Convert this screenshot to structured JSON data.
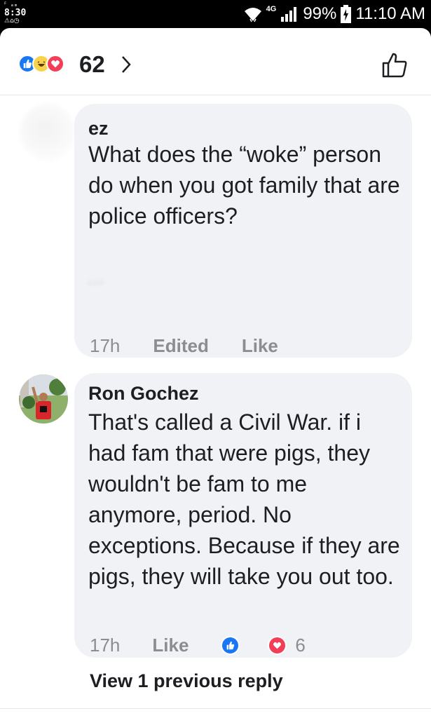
{
  "status_bar": {
    "left_mini": "ꟳ ₐₘ",
    "left_clock": "8:30",
    "left_icons": "⚠⌂◷",
    "network": "4G",
    "battery": "99%",
    "time": "11:10 AM",
    "icons": [
      "wifi-icon",
      "signal-icon",
      "battery-icon"
    ]
  },
  "reactions": {
    "icons": [
      "like-reaction-icon",
      "haha-reaction-icon",
      "love-reaction-icon"
    ],
    "count": "62"
  },
  "comments": [
    {
      "author": "ez",
      "text": "What does the “woke” person do when you got family that are police officers?",
      "blurred_tail": "...",
      "time": "17h",
      "edited": "Edited",
      "like_label": "Like"
    },
    {
      "author": "Ron Gochez",
      "text": "That's called a Civil War. if i had fam that were pigs, they wouldn't be fam to me anymore, period. No exceptions. Because if they are pigs, they will take you out too.",
      "time": "17h",
      "like_label": "Like",
      "reaction_count": "6"
    }
  ],
  "view_previous": "View 1 previous reply",
  "colors": {
    "like_blue": "#1877f2",
    "love_red": "#f33e58",
    "haha_yellow": "#f7d24a",
    "bubble_bg": "#f0f2f5",
    "meta_gray": "#8a8d91"
  }
}
